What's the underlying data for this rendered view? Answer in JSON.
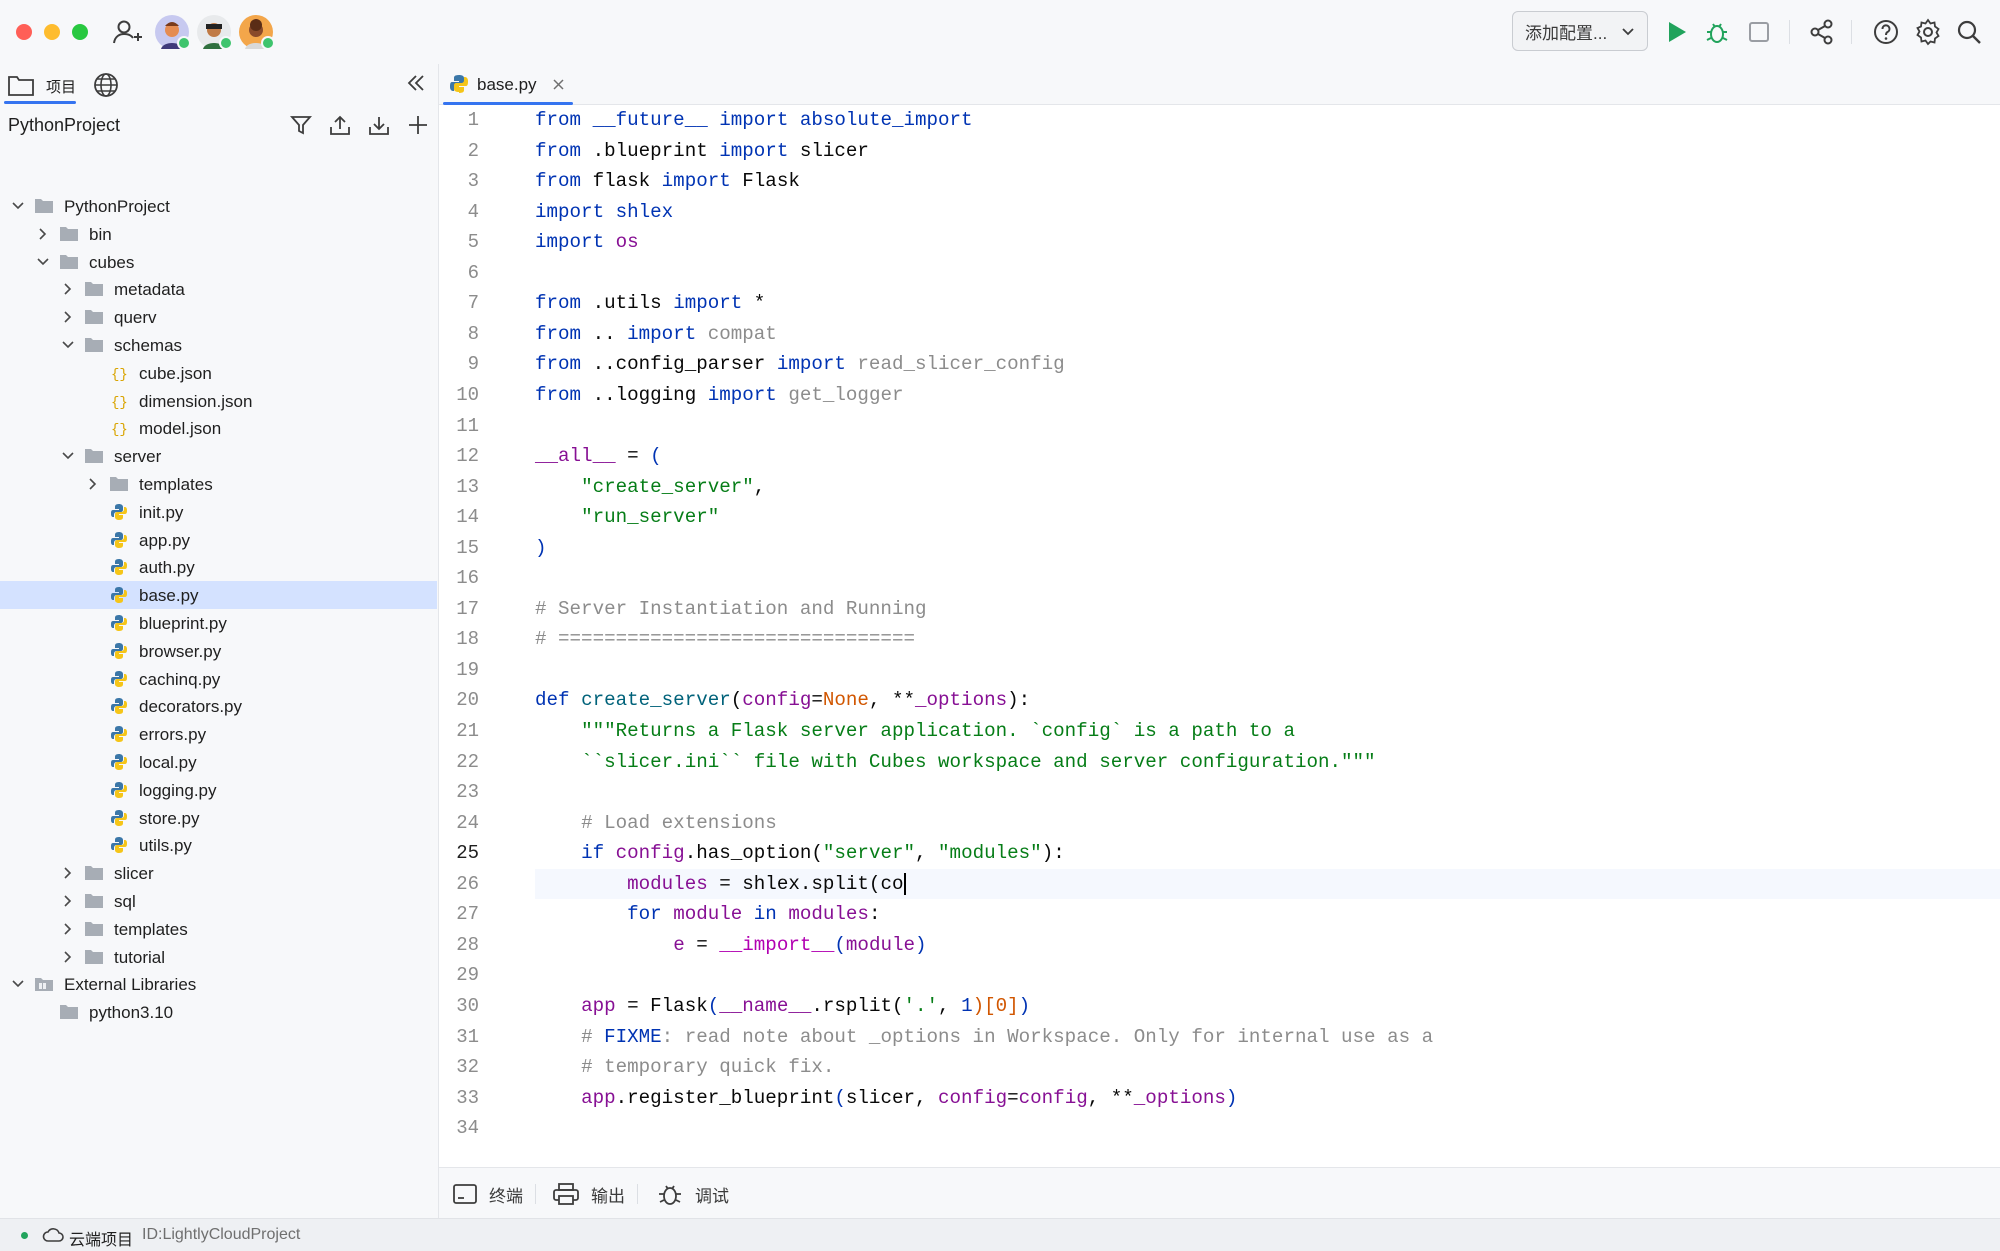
{
  "titlebar": {
    "window_controls": [
      "close",
      "minimize",
      "maximize"
    ],
    "add_user_icon": "add-user-icon",
    "avatars": [
      "avatar-1",
      "avatar-2",
      "avatar-3"
    ],
    "config_select": {
      "label": "添加配置...",
      "icon": "chevron-down-icon"
    },
    "actions": [
      "run-icon",
      "debug-icon",
      "stop-icon",
      "share-icon",
      "help-icon",
      "settings-icon",
      "search-icon"
    ]
  },
  "project_panel": {
    "tabs": [
      {
        "label": "项目",
        "icon": "folder-icon"
      },
      {
        "icon": "globe-icon"
      }
    ],
    "title": "PythonProject",
    "toolbar_icons": [
      "filter-icon",
      "upload-icon",
      "download-icon",
      "plus-icon"
    ],
    "tree": [
      {
        "label": "PythonProject",
        "level": 0,
        "type": "project",
        "expanded": true
      },
      {
        "label": "bin",
        "level": 1,
        "type": "folder",
        "expanded": false
      },
      {
        "label": "cubes",
        "level": 1,
        "type": "folder",
        "expanded": true
      },
      {
        "label": "metadata",
        "level": 2,
        "type": "folder",
        "expanded": false
      },
      {
        "label": "querv",
        "level": 2,
        "type": "folder",
        "expanded": false
      },
      {
        "label": "schemas",
        "level": 2,
        "type": "folder",
        "expanded": true
      },
      {
        "label": "cube.json",
        "level": 3,
        "type": "json"
      },
      {
        "label": "dimension.json",
        "level": 3,
        "type": "json"
      },
      {
        "label": "model.json",
        "level": 3,
        "type": "json"
      },
      {
        "label": "server",
        "level": 2,
        "type": "folder",
        "expanded": true
      },
      {
        "label": "templates",
        "level": 3,
        "type": "folder",
        "expanded": false
      },
      {
        "label": "init.py",
        "level": 3,
        "type": "py"
      },
      {
        "label": "app.py",
        "level": 3,
        "type": "py"
      },
      {
        "label": "auth.py",
        "level": 3,
        "type": "py"
      },
      {
        "label": "base.py",
        "level": 3,
        "type": "py",
        "selected": true
      },
      {
        "label": "blueprint.py",
        "level": 3,
        "type": "py"
      },
      {
        "label": "browser.py",
        "level": 3,
        "type": "py"
      },
      {
        "label": "cachinq.py",
        "level": 3,
        "type": "py"
      },
      {
        "label": "decorators.py",
        "level": 3,
        "type": "py"
      },
      {
        "label": "errors.py",
        "level": 3,
        "type": "py"
      },
      {
        "label": "local.py",
        "level": 3,
        "type": "py"
      },
      {
        "label": "logging.py",
        "level": 3,
        "type": "py"
      },
      {
        "label": "store.py",
        "level": 3,
        "type": "py"
      },
      {
        "label": "utils.py",
        "level": 3,
        "type": "py"
      },
      {
        "label": "slicer",
        "level": 2,
        "type": "folder",
        "expanded": false
      },
      {
        "label": "sql",
        "level": 2,
        "type": "folder",
        "expanded": false
      },
      {
        "label": "templates",
        "level": 2,
        "type": "folder",
        "expanded": false
      },
      {
        "label": "tutorial",
        "level": 2,
        "type": "folder",
        "expanded": false
      },
      {
        "label": "External Libraries",
        "level": 0,
        "type": "library",
        "expanded": true
      },
      {
        "label": "python3.10",
        "level": 1,
        "type": "folder-plain"
      }
    ]
  },
  "editor": {
    "tab": {
      "label": "base.py",
      "icon": "python-file-icon",
      "close_icon": "close-icon"
    },
    "current_line": 25,
    "lines": [
      [
        [
          "k",
          "from"
        ],
        [
          "t",
          " "
        ],
        [
          "k",
          "__future__"
        ],
        [
          "t",
          " "
        ],
        [
          "k",
          "import"
        ],
        [
          "t",
          " "
        ],
        [
          "k",
          "absolute_import"
        ]
      ],
      [
        [
          "k",
          "from"
        ],
        [
          "t",
          " .blueprint "
        ],
        [
          "k",
          "import"
        ],
        [
          "t",
          " slicer"
        ]
      ],
      [
        [
          "k",
          "from"
        ],
        [
          "t",
          " flask "
        ],
        [
          "k",
          "import"
        ],
        [
          "t",
          " Flask"
        ]
      ],
      [
        [
          "k",
          "import"
        ],
        [
          "t",
          " "
        ],
        [
          "k",
          "shlex"
        ]
      ],
      [
        [
          "k",
          "import"
        ],
        [
          "t",
          " "
        ],
        [
          "n",
          "os"
        ]
      ],
      [],
      [
        [
          "k",
          "from"
        ],
        [
          "t",
          " .utils "
        ],
        [
          "k",
          "import"
        ],
        [
          "t",
          " *"
        ]
      ],
      [
        [
          "k",
          "from"
        ],
        [
          "t",
          " .. "
        ],
        [
          "k",
          "import"
        ],
        [
          "t",
          " "
        ],
        [
          "c",
          "compat"
        ]
      ],
      [
        [
          "k",
          "from"
        ],
        [
          "t",
          " ..config_parser "
        ],
        [
          "k",
          "import"
        ],
        [
          "t",
          " "
        ],
        [
          "c",
          "read_slicer_config"
        ]
      ],
      [
        [
          "k",
          "from"
        ],
        [
          "t",
          " ..logging "
        ],
        [
          "k",
          "import"
        ],
        [
          "t",
          " "
        ],
        [
          "c",
          "get_logger"
        ]
      ],
      [],
      [
        [
          "n",
          "__all__"
        ],
        [
          "t",
          " = "
        ],
        [
          "p",
          "("
        ]
      ],
      [
        [
          "t",
          "    "
        ],
        [
          "s",
          "\"create_server\""
        ],
        [
          "t",
          ","
        ]
      ],
      [
        [
          "t",
          "    "
        ],
        [
          "s",
          "\"run_server\""
        ]
      ],
      [
        [
          "p",
          ")"
        ]
      ],
      [],
      [
        [
          "c",
          "# Server Instantiation and Running"
        ]
      ],
      [
        [
          "c",
          "# ==============================="
        ]
      ],
      [],
      [
        [
          "k",
          "def"
        ],
        [
          "t",
          " "
        ],
        [
          "fn",
          "create_server"
        ],
        [
          "t",
          "("
        ],
        [
          "n",
          "config"
        ],
        [
          "t",
          "="
        ],
        [
          "o",
          "None"
        ],
        [
          "t",
          ", **"
        ],
        [
          "n",
          "_options"
        ],
        [
          "t",
          "):"
        ]
      ],
      [
        [
          "t",
          "    "
        ],
        [
          "s",
          "\"\"\"Returns a Flask server application. `config` is a path to a"
        ]
      ],
      [
        [
          "t",
          "    "
        ],
        [
          "s",
          "``slicer.ini`` file with Cubes workspace and server configuration.\"\"\""
        ]
      ],
      [],
      [
        [
          "t",
          "    "
        ],
        [
          "c",
          "# Load extensions"
        ]
      ],
      [
        [
          "t",
          "    "
        ],
        [
          "k",
          "if"
        ],
        [
          "t",
          " "
        ],
        [
          "n",
          "config"
        ],
        [
          "t",
          ".has_option("
        ],
        [
          "s",
          "\"server\""
        ],
        [
          "t",
          ", "
        ],
        [
          "s",
          "\"modules\""
        ],
        [
          "t",
          "):"
        ]
      ],
      [
        [
          "t",
          "        "
        ],
        [
          "n",
          "modules"
        ],
        [
          "t",
          " = shlex.split(co"
        ],
        [
          "cursor",
          ""
        ]
      ],
      [
        [
          "t",
          "        "
        ],
        [
          "k",
          "for"
        ],
        [
          "t",
          " "
        ],
        [
          "n",
          "module"
        ],
        [
          "t",
          " "
        ],
        [
          "k",
          "in"
        ],
        [
          "t",
          " "
        ],
        [
          "n",
          "modules"
        ],
        [
          "t",
          ":"
        ]
      ],
      [
        [
          "t",
          "            "
        ],
        [
          "n",
          "e"
        ],
        [
          "t",
          " = "
        ],
        [
          "dn",
          "__import__"
        ],
        [
          "p",
          "("
        ],
        [
          "n",
          "module"
        ],
        [
          "p",
          ")"
        ]
      ],
      [],
      [
        [
          "t",
          "    "
        ],
        [
          "n",
          "app"
        ],
        [
          "t",
          " = Flask"
        ],
        [
          "p",
          "("
        ],
        [
          "n",
          "__name__"
        ],
        [
          "t",
          ".rsplit("
        ],
        [
          "s",
          "'.'"
        ],
        [
          "t",
          ", "
        ],
        [
          "p",
          "1"
        ],
        [
          "o",
          ")[0]"
        ],
        [
          "p",
          ")"
        ]
      ],
      [
        [
          "t",
          "    "
        ],
        [
          "c",
          "# "
        ],
        [
          "k",
          "FIXME"
        ],
        [
          "c",
          ": read note about _options in Workspace. Only for internal use as a"
        ]
      ],
      [
        [
          "t",
          "    "
        ],
        [
          "c",
          "# temporary quick fix."
        ]
      ],
      [
        [
          "t",
          "    "
        ],
        [
          "n",
          "app"
        ],
        [
          "t",
          ".register_blueprint"
        ],
        [
          "p",
          "("
        ],
        [
          "t",
          "slicer, "
        ],
        [
          "n",
          "config"
        ],
        [
          "t",
          "="
        ],
        [
          "n",
          "config"
        ],
        [
          "t",
          ", **"
        ],
        [
          "n",
          "_options"
        ],
        [
          "p",
          ")"
        ]
      ],
      []
    ]
  },
  "toolwindows": [
    {
      "label": "终端",
      "icon": "terminal-icon"
    },
    {
      "label": "输出",
      "icon": "printer-icon"
    },
    {
      "label": "调试",
      "icon": "bug-icon"
    }
  ],
  "statusbar": {
    "project_label": "云端项目",
    "project_id": "ID:LightlyCloudProject"
  },
  "colors": {
    "accent": "#3574f0",
    "selection": "#d4e2ff",
    "run": "#21a35c"
  }
}
